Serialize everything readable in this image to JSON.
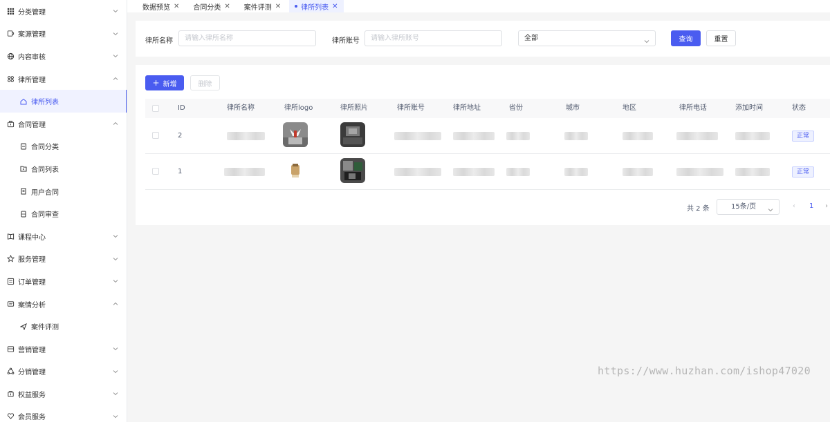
{
  "sidebar": {
    "items": [
      {
        "icon": "grid-icon",
        "label": "分类管理",
        "arrow": "down"
      },
      {
        "icon": "case-icon",
        "label": "案源管理",
        "arrow": "down"
      },
      {
        "icon": "globe-icon",
        "label": "内容审核",
        "arrow": "down"
      },
      {
        "icon": "apps-icon",
        "label": "律所管理",
        "arrow": "up"
      }
    ],
    "law_sub": [
      {
        "icon": "home-icon",
        "label": "律所列表",
        "active": true
      }
    ],
    "contract": {
      "icon": "briefcase-icon",
      "label": "合同管理",
      "arrow": "up"
    },
    "contract_sub": [
      {
        "icon": "file-icon",
        "label": "合同分类"
      },
      {
        "icon": "folder-icon",
        "label": "合同列表"
      },
      {
        "icon": "doc-icon",
        "label": "用户合同"
      },
      {
        "icon": "clipboard-icon",
        "label": "合同审查"
      }
    ],
    "more": [
      {
        "icon": "book-icon",
        "label": "课程中心",
        "arrow": "down"
      },
      {
        "icon": "star-icon",
        "label": "服务管理",
        "arrow": "down"
      },
      {
        "icon": "list-icon",
        "label": "订单管理",
        "arrow": "down"
      },
      {
        "icon": "chat-icon",
        "label": "案情分析",
        "arrow": "up"
      }
    ],
    "analysis_sub": [
      {
        "icon": "send-icon",
        "label": "案件评测"
      }
    ],
    "tail": [
      {
        "icon": "store-icon",
        "label": "营销管理",
        "arrow": "down"
      },
      {
        "icon": "share-icon",
        "label": "分销管理",
        "arrow": "down"
      },
      {
        "icon": "shield-icon",
        "label": "权益服务",
        "arrow": "down"
      },
      {
        "icon": "heart-icon",
        "label": "会员服务",
        "arrow": "down"
      }
    ]
  },
  "tabs": [
    {
      "label": "数据预览",
      "active": false
    },
    {
      "label": "合同分类",
      "active": false
    },
    {
      "label": "案件评测",
      "active": false
    },
    {
      "label": "律所列表",
      "active": true
    }
  ],
  "search": {
    "name_label": "律所名称",
    "name_placeholder": "请输入律所名称",
    "account_label": "律所账号",
    "account_placeholder": "请输入律所账号",
    "status_value": "全部",
    "query_label": "查询",
    "reset_label": "重置"
  },
  "toolbar": {
    "add_label": "新增",
    "delete_label": "删除"
  },
  "table": {
    "headers": [
      "ID",
      "律所名称",
      "律所logo",
      "律所照片",
      "律所账号",
      "律所地址",
      "省份",
      "城市",
      "地区",
      "律所电话",
      "添加时间",
      "状态"
    ],
    "rows": [
      {
        "id": "2",
        "status": "正常"
      },
      {
        "id": "1",
        "status": "正常"
      }
    ]
  },
  "pagination": {
    "total": "共 2 条",
    "page_size": "15条/页",
    "current": "1"
  },
  "watermark": "https://www.huzhan.com/ishop47020",
  "colors": {
    "accent": "#4a5cf0"
  }
}
